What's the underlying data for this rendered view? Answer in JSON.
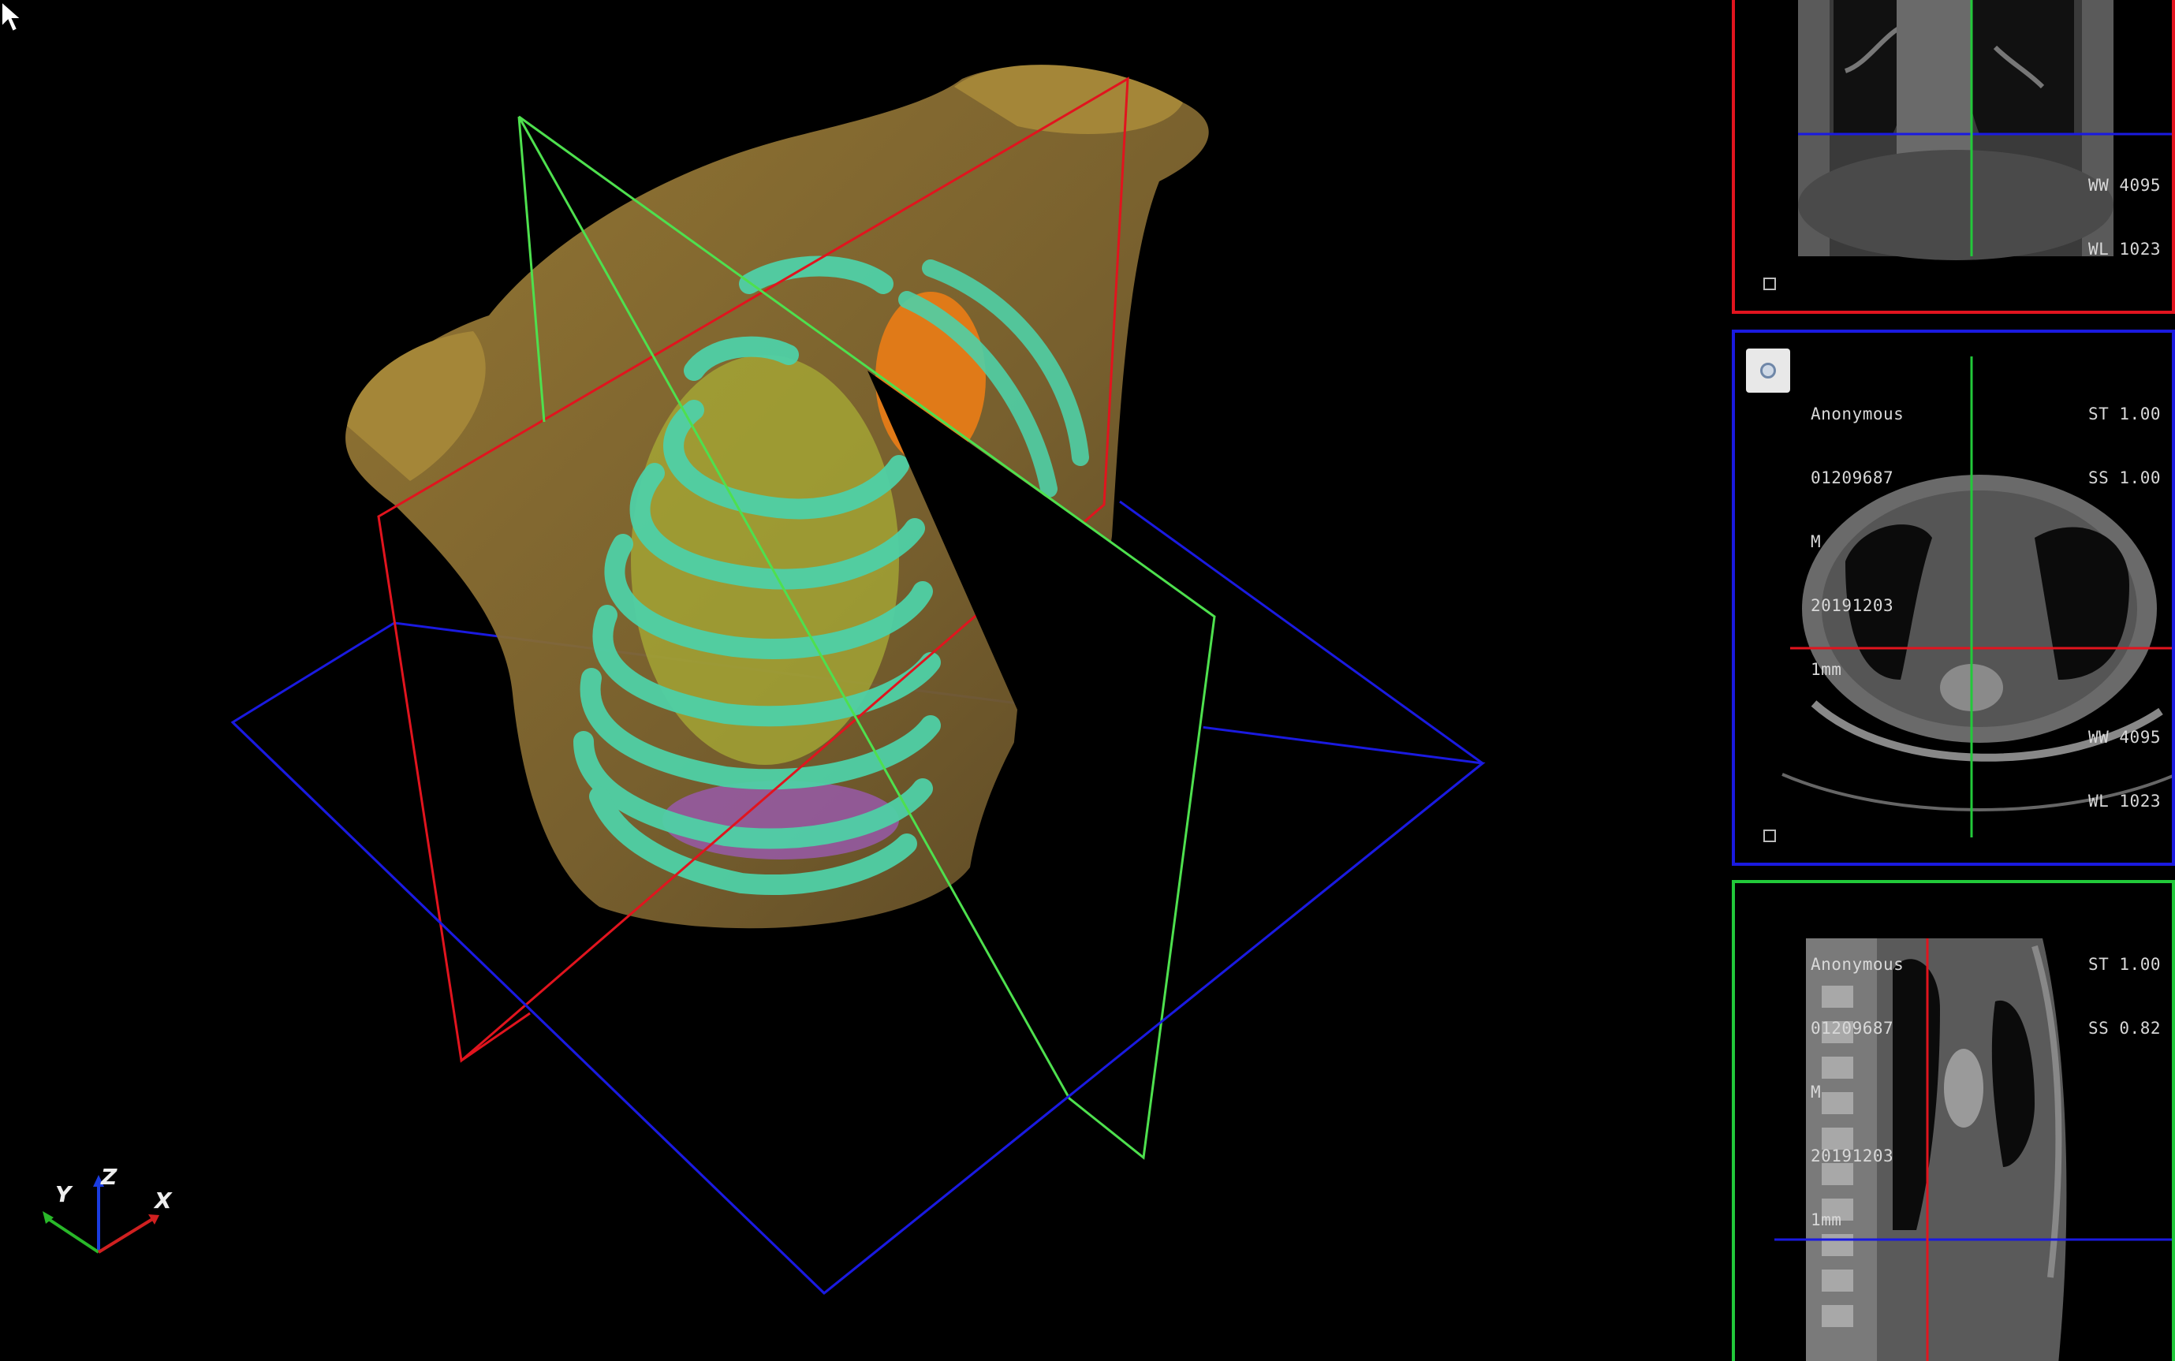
{
  "axes_triad": {
    "x_label": "X",
    "y_label": "Y",
    "z_label": "Z"
  },
  "panels": {
    "coronal": {
      "window_width": "WW 4095",
      "window_level": "WL 1023",
      "frame_color": "#e1141e"
    },
    "axial": {
      "patient_name": "Anonymous",
      "patient_id": "01209687",
      "sex": "M",
      "date": "20191203",
      "slice_thickness": "1mm",
      "st": "ST 1.00",
      "ss": "SS 1.00",
      "window_width": "WW 4095",
      "window_level": "WL 1023",
      "frame_color": "#1a1ae0"
    },
    "sagittal": {
      "patient_name": "Anonymous",
      "patient_id": "01209687",
      "sex": "M",
      "date": "20191203",
      "slice_thickness": "1mm",
      "st": "ST 1.00",
      "ss": "SS 0.82",
      "frame_color": "#22c93a"
    }
  },
  "colors": {
    "plane_red": "#e1141e",
    "plane_green": "#4ee04e",
    "plane_blue": "#1a1ae0",
    "skin": "#8a6e30",
    "bone": "#4fd0a6",
    "heart": "#e07a18",
    "lung": "#a8ac36"
  },
  "icons": {
    "camera_button": "camera-reset-icon",
    "pointer": "mouse-pointer-icon"
  }
}
